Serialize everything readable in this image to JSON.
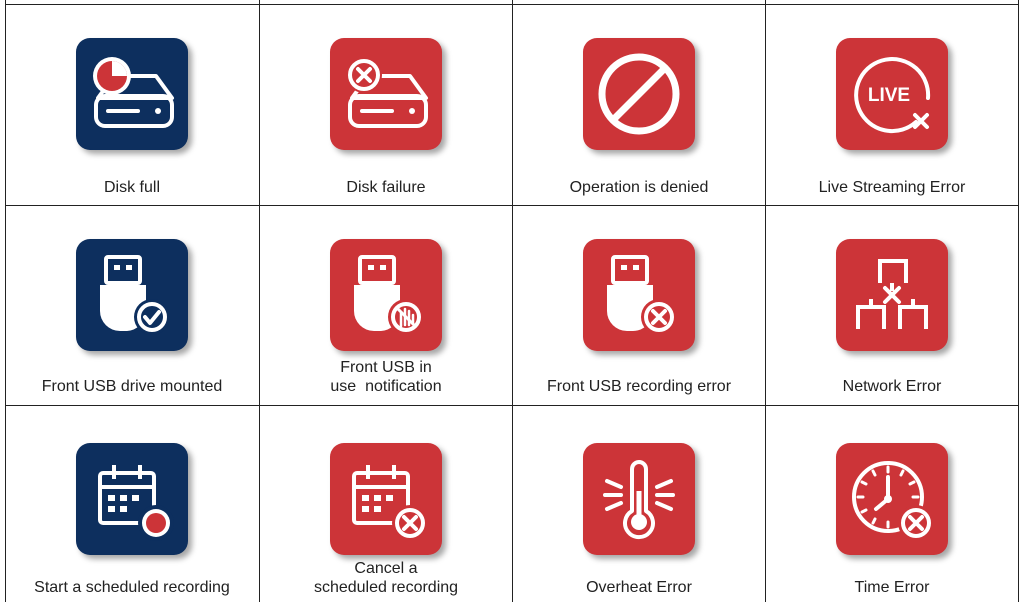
{
  "colors": {
    "navy": "#0d2f5e",
    "red": "#cc3438",
    "grid": "#222222",
    "text": "#222222"
  },
  "rows": [
    [
      {
        "label": "Disk full",
        "icon": "disk-full-icon",
        "tile": "navy"
      },
      {
        "label": "Disk failure",
        "icon": "disk-failure-icon",
        "tile": "red"
      },
      {
        "label": "Operation is denied",
        "icon": "prohibited-icon",
        "tile": "red"
      },
      {
        "label": "Live Streaming Error",
        "icon": "live-error-icon",
        "tile": "red"
      }
    ],
    [
      {
        "label": "Front USB drive mounted",
        "icon": "usb-check-icon",
        "tile": "navy"
      },
      {
        "label_line1": "Front USB in",
        "label_line2": "use  notification",
        "icon": "usb-in-use-icon",
        "tile": "red"
      },
      {
        "label": "Front USB recording error",
        "icon": "usb-error-icon",
        "tile": "red"
      },
      {
        "label": "Network Error",
        "icon": "network-error-icon",
        "tile": "red"
      }
    ],
    [
      {
        "label": "Start a scheduled recording",
        "icon": "calendar-record-icon",
        "tile": "navy"
      },
      {
        "label_line1": "Cancel a",
        "label_line2": "scheduled recording",
        "icon": "calendar-cancel-icon",
        "tile": "red"
      },
      {
        "label": "Overheat Error",
        "icon": "thermometer-icon",
        "tile": "red"
      },
      {
        "label": "Time Error",
        "icon": "clock-error-icon",
        "tile": "red"
      }
    ]
  ]
}
